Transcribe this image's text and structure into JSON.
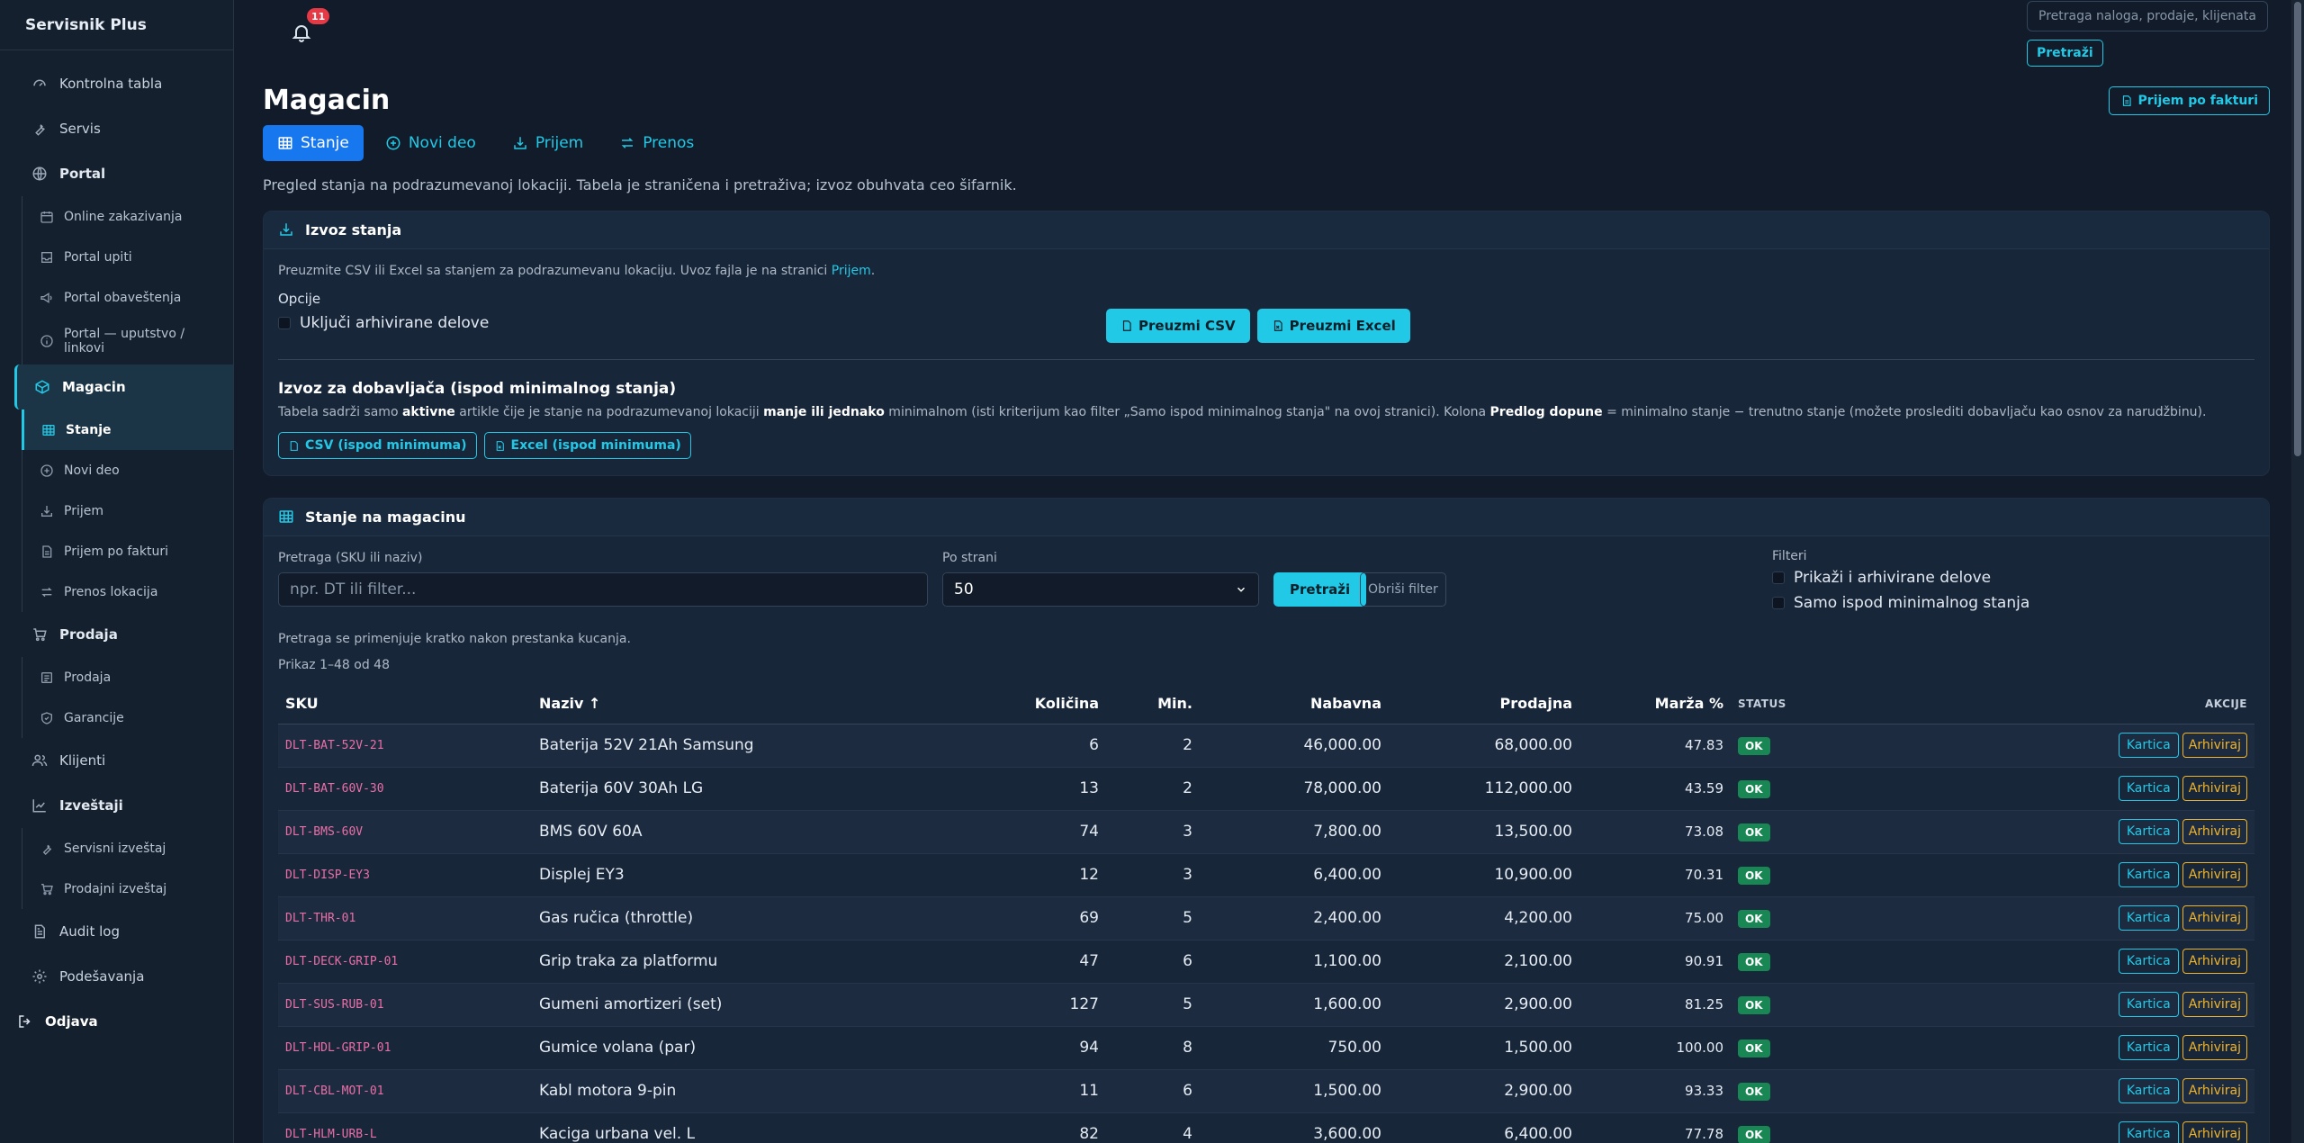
{
  "brand": "Servisnik Plus",
  "sidebar": {
    "items": [
      {
        "label": "Kontrolna tabla",
        "icon": "dashboard-icon"
      },
      {
        "label": "Servis",
        "icon": "wrench-icon"
      },
      {
        "label": "Portal",
        "icon": "globe-icon"
      },
      {
        "label": "Online zakazivanja",
        "icon": "calendar-icon"
      },
      {
        "label": "Portal upiti",
        "icon": "inbox-icon"
      },
      {
        "label": "Portal obaveštenja",
        "icon": "megaphone-icon"
      },
      {
        "label": "Portal — uputstvo / linkovi",
        "icon": "info-icon"
      },
      {
        "label": "Magacin",
        "icon": "box-icon"
      },
      {
        "label": "Stanje",
        "icon": "table-icon"
      },
      {
        "label": "Novi deo",
        "icon": "plus-circle-icon"
      },
      {
        "label": "Prijem",
        "icon": "receive-icon"
      },
      {
        "label": "Prijem po fakturi",
        "icon": "invoice-icon"
      },
      {
        "label": "Prenos lokacija",
        "icon": "transfer-icon"
      },
      {
        "label": "Prodaja",
        "icon": "cart-icon"
      },
      {
        "label": "Prodaja",
        "icon": "receipt-icon"
      },
      {
        "label": "Garancije",
        "icon": "shield-icon"
      },
      {
        "label": "Klijenti",
        "icon": "users-icon"
      },
      {
        "label": "Izveštaji",
        "icon": "chart-icon"
      },
      {
        "label": "Servisni izveštaj",
        "icon": "wrench-icon"
      },
      {
        "label": "Prodajni izveštaj",
        "icon": "cart-icon"
      },
      {
        "label": "Audit log",
        "icon": "log-icon"
      },
      {
        "label": "Podešavanja",
        "icon": "gear-icon"
      },
      {
        "label": "Odjava",
        "icon": "logout-icon"
      }
    ]
  },
  "topbar": {
    "notifications_count": "11",
    "search_placeholder": "Pretraga naloga, prodaje, klijenata...",
    "search_button": "Pretraži"
  },
  "page": {
    "title": "Magacin",
    "invoice_button": "Prijem po fakturi",
    "tabs": [
      {
        "label": "Stanje",
        "icon": "table-icon"
      },
      {
        "label": "Novi deo",
        "icon": "plus-circle-icon"
      },
      {
        "label": "Prijem",
        "icon": "receive-icon"
      },
      {
        "label": "Prenos",
        "icon": "transfer-icon"
      }
    ],
    "description": "Pregled stanja na podrazumevanoj lokaciji. Tabela je straničena i pretraživa; izvoz obuhvata ceo šifarnik."
  },
  "export_card": {
    "title": "Izvoz stanja",
    "text_before": "Preuzmite CSV ili Excel sa stanjem za podrazumevanu lokaciju. Uvoz fajla je na stranici ",
    "text_link": "Prijem",
    "text_after": ".",
    "options_label": "Opcije",
    "include_archived": "Uključi arhivirane delove",
    "download_csv": "Preuzmi CSV",
    "download_excel": "Preuzmi Excel",
    "supplier_title": "Izvoz za dobavljača (ispod minimalnog stanja)",
    "supplier_desc_1": "Tabela sadrži samo ",
    "supplier_desc_b1": "aktivne",
    "supplier_desc_2": " artikle čije je stanje na podrazumevanoj lokaciji ",
    "supplier_desc_b2": "manje ili jednako",
    "supplier_desc_3": " minimalnom (isti kriterijum kao filter „Samo ispod minimalnog stanja\" na ovoj stranici). Kolona ",
    "supplier_desc_b3": "Predlog dopune",
    "supplier_desc_4": " = minimalno stanje − trenutno stanje (možete proslediti dobavljaču kao osnov za narudžbinu).",
    "csv_min": "CSV (ispod minimuma)",
    "excel_min": "Excel (ispod minimuma)"
  },
  "stock_card": {
    "title": "Stanje na magacinu",
    "search_label": "Pretraga (SKU ili naziv)",
    "search_placeholder": "npr. DT ili filter...",
    "per_page_label": "Po strani",
    "per_page_value": "50",
    "search_button": "Pretraži",
    "clear_button": "Obriši filter",
    "filters_label": "Filteri",
    "show_archived": "Prikaži i arhivirane delove",
    "only_below_min": "Samo ispod minimalnog stanja",
    "hint": "Pretraga se primenjuje kratko nakon prestanka kucanja.",
    "showing": "Prikaz 1–48 od 48",
    "columns": {
      "sku": "SKU",
      "naziv": "Naziv ↑",
      "kolicina": "Količina",
      "min": "Min.",
      "nabavna": "Nabavna",
      "prodajna": "Prodajna",
      "marza": "Marža %",
      "status": "STATUS",
      "akcije": "AKCIJE"
    },
    "action_card": "Kartica",
    "action_archive": "Arhiviraj",
    "rows": [
      {
        "sku": "DLT-BAT-52V-21",
        "naziv": "Baterija 52V 21Ah Samsung",
        "kolicina": "6",
        "min": "2",
        "nabavna": "46,000.00",
        "prodajna": "68,000.00",
        "marza": "47.83",
        "status": "OK"
      },
      {
        "sku": "DLT-BAT-60V-30",
        "naziv": "Baterija 60V 30Ah LG",
        "kolicina": "13",
        "min": "2",
        "nabavna": "78,000.00",
        "prodajna": "112,000.00",
        "marza": "43.59",
        "status": "OK"
      },
      {
        "sku": "DLT-BMS-60V",
        "naziv": "BMS 60V 60A",
        "kolicina": "74",
        "min": "3",
        "nabavna": "7,800.00",
        "prodajna": "13,500.00",
        "marza": "73.08",
        "status": "OK"
      },
      {
        "sku": "DLT-DISP-EY3",
        "naziv": "Displej EY3",
        "kolicina": "12",
        "min": "3",
        "nabavna": "6,400.00",
        "prodajna": "10,900.00",
        "marza": "70.31",
        "status": "OK"
      },
      {
        "sku": "DLT-THR-01",
        "naziv": "Gas ručica (throttle)",
        "kolicina": "69",
        "min": "5",
        "nabavna": "2,400.00",
        "prodajna": "4,200.00",
        "marza": "75.00",
        "status": "OK"
      },
      {
        "sku": "DLT-DECK-GRIP-01",
        "naziv": "Grip traka za platformu",
        "kolicina": "47",
        "min": "6",
        "nabavna": "1,100.00",
        "prodajna": "2,100.00",
        "marza": "90.91",
        "status": "OK"
      },
      {
        "sku": "DLT-SUS-RUB-01",
        "naziv": "Gumeni amortizeri (set)",
        "kolicina": "127",
        "min": "5",
        "nabavna": "1,600.00",
        "prodajna": "2,900.00",
        "marza": "81.25",
        "status": "OK"
      },
      {
        "sku": "DLT-HDL-GRIP-01",
        "naziv": "Gumice volana (par)",
        "kolicina": "94",
        "min": "8",
        "nabavna": "750.00",
        "prodajna": "1,500.00",
        "marza": "100.00",
        "status": "OK"
      },
      {
        "sku": "DLT-CBL-MOT-01",
        "naziv": "Kabl motora 9-pin",
        "kolicina": "11",
        "min": "6",
        "nabavna": "1,500.00",
        "prodajna": "2,900.00",
        "marza": "93.33",
        "status": "OK"
      },
      {
        "sku": "DLT-HLM-URB-L",
        "naziv": "Kaciga urbana vel. L",
        "kolicina": "82",
        "min": "4",
        "nabavna": "3,600.00",
        "prodajna": "6,400.00",
        "marza": "77.78",
        "status": "OK"
      }
    ]
  }
}
